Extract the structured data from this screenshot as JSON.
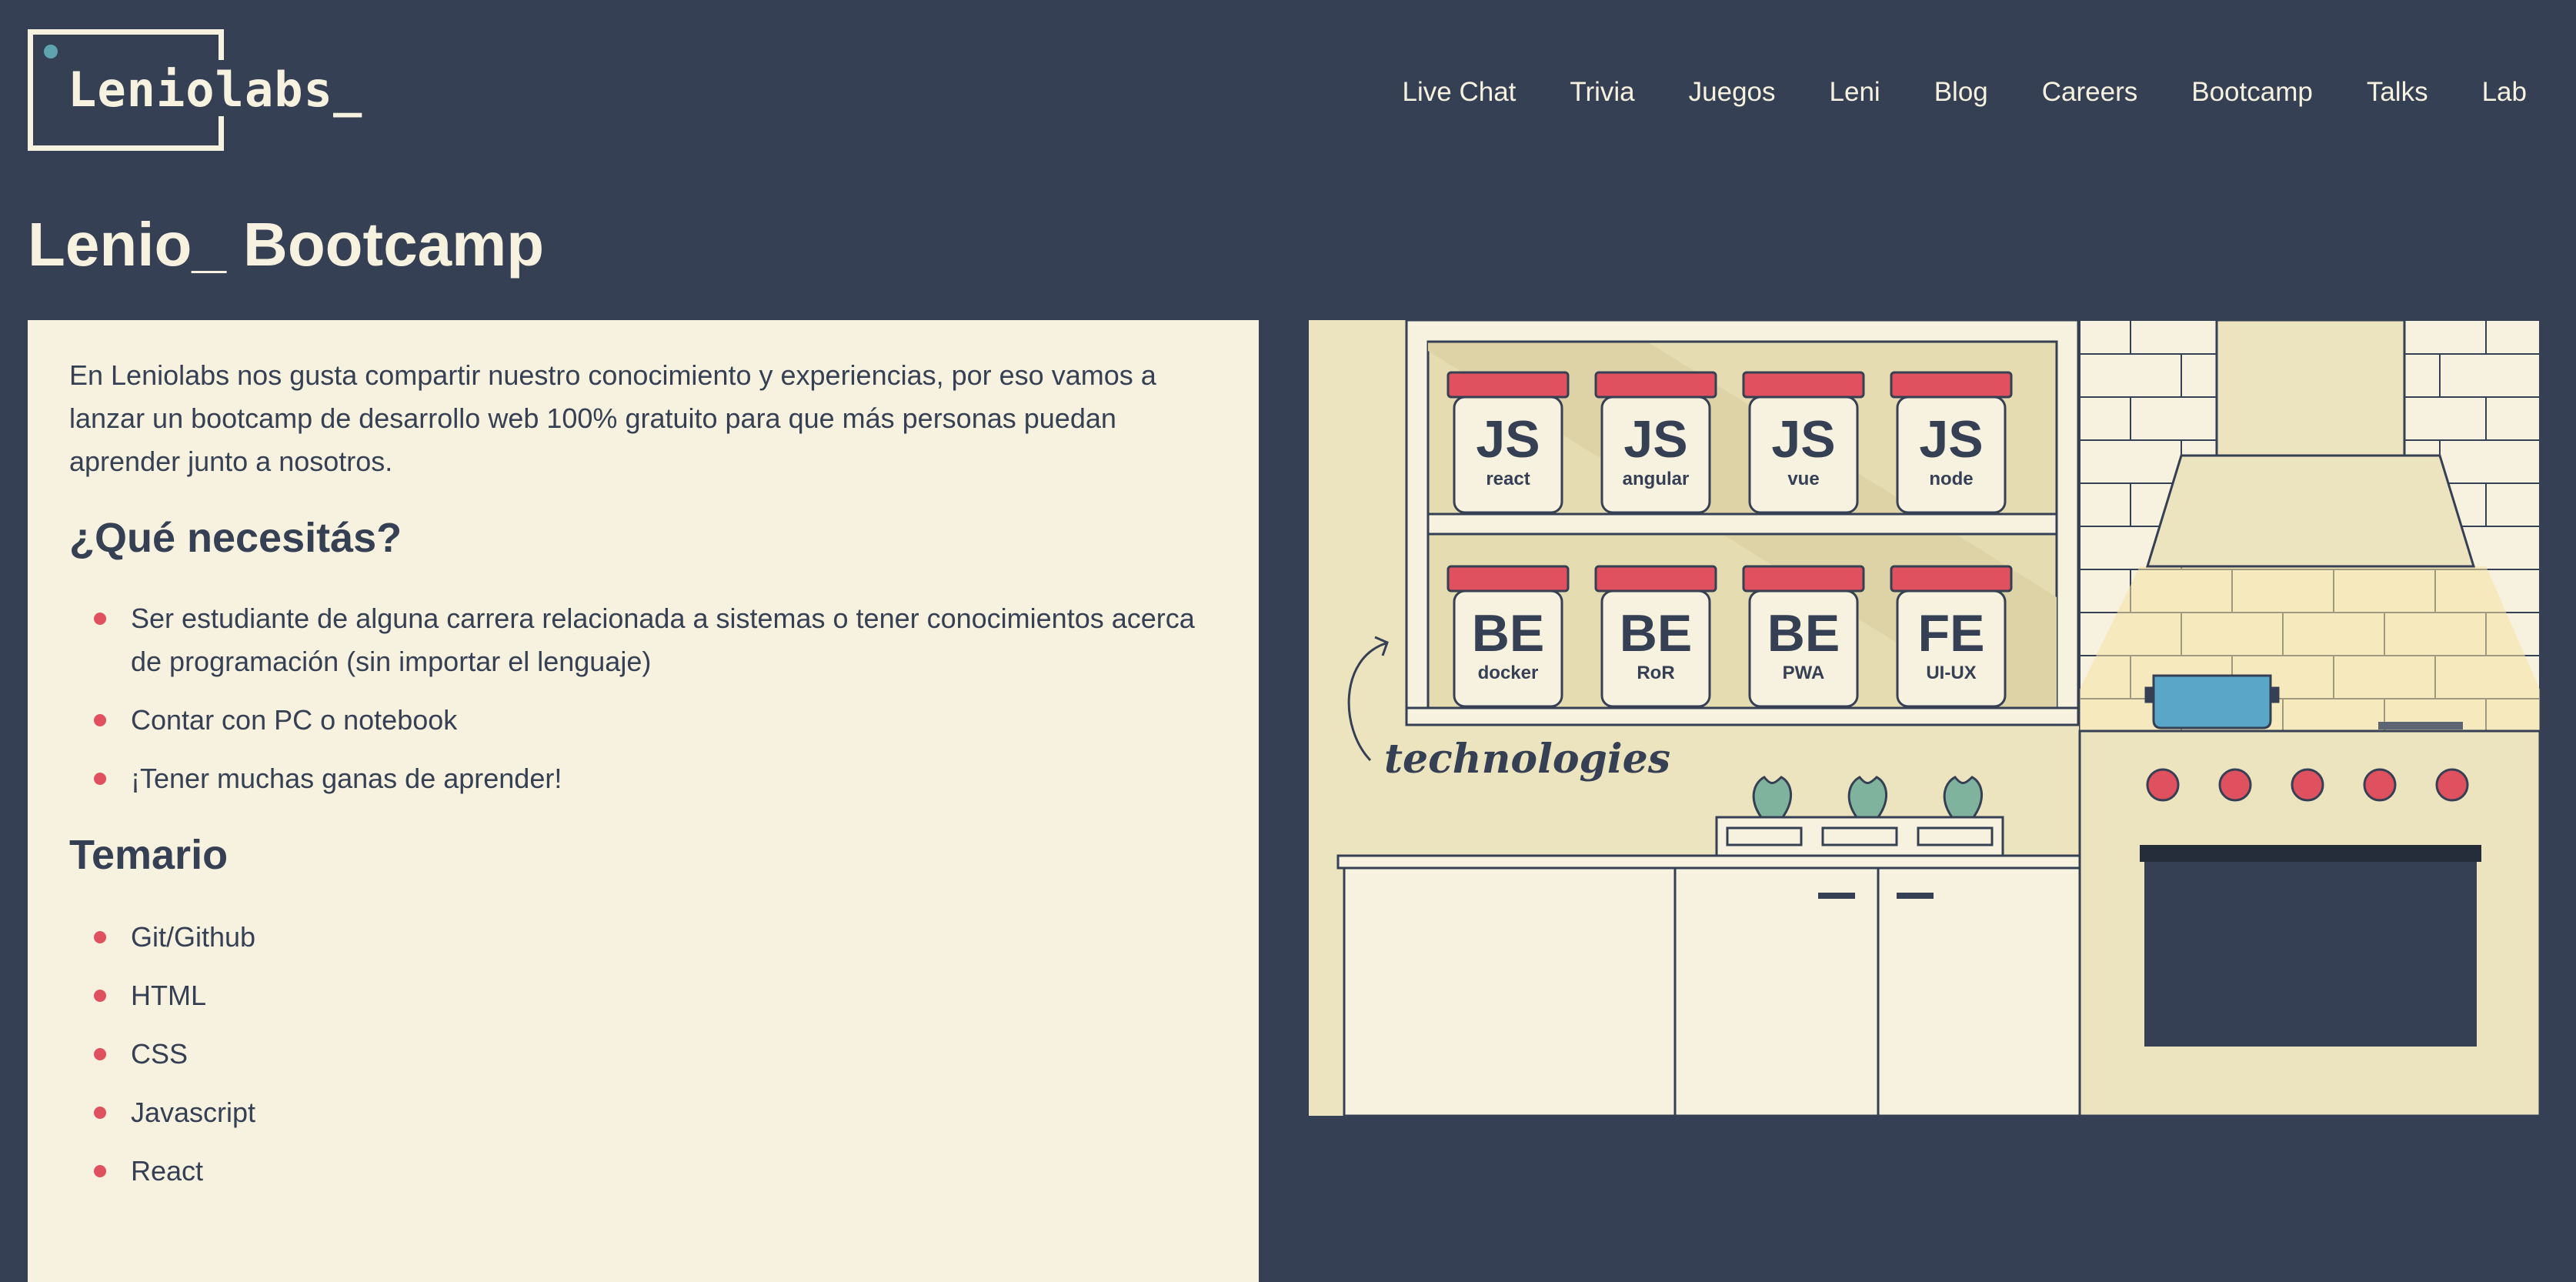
{
  "logo": {
    "text": "Leniolabs_"
  },
  "nav": [
    "Live Chat",
    "Trivia",
    "Juegos",
    "Leni",
    "Blog",
    "Careers",
    "Bootcamp",
    "Talks",
    "Lab"
  ],
  "page_title": "Lenio_ Bootcamp",
  "content": {
    "intro": "En Leniolabs nos gusta compartir nuestro conocimiento y experiencias, por eso vamos a lanzar un bootcamp de desarrollo web 100% gratuito para que más personas puedan aprender junto a nosotros.",
    "need_title": "¿Qué necesitás?",
    "need_items": [
      "Ser estudiante de alguna carrera relacionada a sistemas o tener conocimientos acerca de programación (sin importar el lenguaje)",
      "Contar con PC o notebook",
      "¡Tener muchas ganas de aprender!"
    ],
    "temario_title": "Temario",
    "temario_items": [
      "Git/Github",
      "HTML",
      "CSS",
      "Javascript",
      "React"
    ]
  },
  "illustration": {
    "jars_top": [
      {
        "big": "JS",
        "small": "react"
      },
      {
        "big": "JS",
        "small": "angular"
      },
      {
        "big": "JS",
        "small": "vue"
      },
      {
        "big": "JS",
        "small": "node"
      }
    ],
    "jars_bottom": [
      {
        "big": "BE",
        "small": "docker"
      },
      {
        "big": "BE",
        "small": "RoR"
      },
      {
        "big": "BE",
        "small": "PWA"
      },
      {
        "big": "FE",
        "small": "UI-UX"
      }
    ],
    "caption": "technologies"
  },
  "colors": {
    "background": "#364054",
    "cream": "#f7f2df",
    "accent_red": "#e0515f",
    "teal": "#5fa3b1",
    "sand": "#ece3bf",
    "pot_blue": "#5aa6c9",
    "plant_green": "#7fb39e"
  }
}
